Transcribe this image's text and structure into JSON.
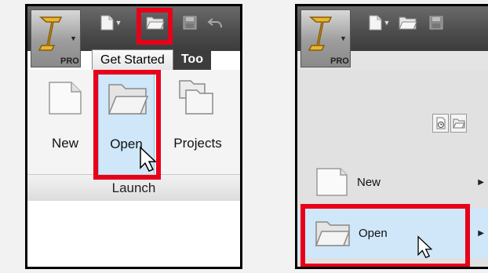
{
  "left_panel": {
    "app_button": {
      "badge": "PRO"
    },
    "tabs": [
      {
        "label": "Get Started"
      },
      {
        "label": "Too"
      }
    ],
    "ribbon_buttons": [
      {
        "label": "New",
        "icon": "new-file-icon"
      },
      {
        "label": "Open",
        "icon": "open-folder-icon"
      },
      {
        "label": "Projects",
        "icon": "projects-icon"
      }
    ],
    "panel_label": "Launch"
  },
  "right_panel": {
    "app_button": {
      "badge": "PRO"
    },
    "menu_items": [
      {
        "label": "New",
        "icon": "new-file-icon"
      },
      {
        "label": "Open",
        "icon": "open-folder-icon"
      }
    ]
  },
  "colors": {
    "highlight": "#e8001a",
    "hover_fill": "#cfe7f8",
    "titlebar": "#4b4b4b"
  }
}
